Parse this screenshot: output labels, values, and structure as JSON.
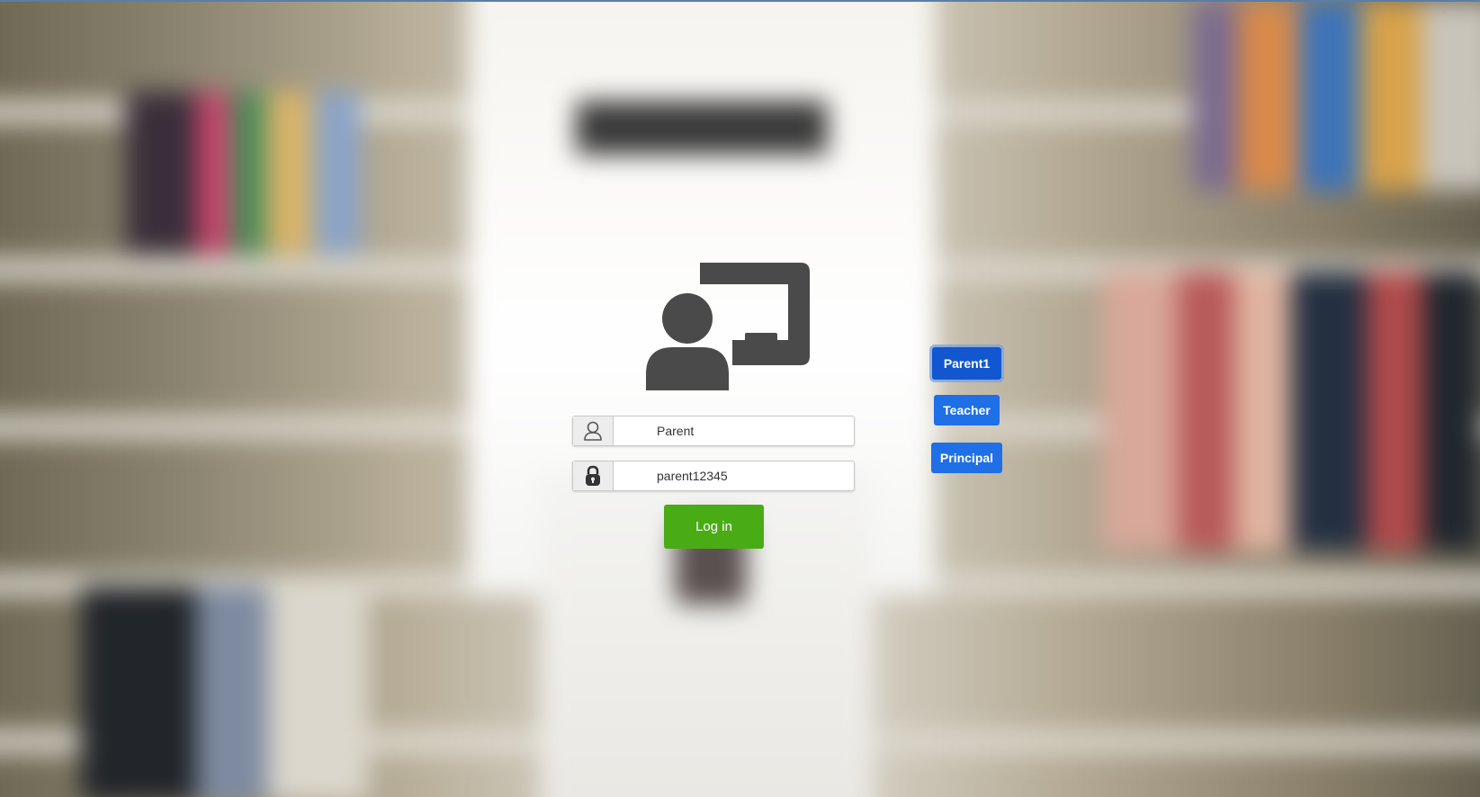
{
  "login": {
    "username_value": "Parent",
    "password_value": "parent12345",
    "login_label": "Log in"
  },
  "quick_roles": {
    "parent1_label": "Parent1",
    "teacher_label": "Teacher",
    "principal_label": "Principal"
  },
  "icons": {
    "logo": "teacher-board-icon",
    "username_addon": "user-icon",
    "password_addon": "lock-icon"
  },
  "colors": {
    "login_button": "#4aac15",
    "role_button": "#1f6fe6",
    "role_button_active": "#1257cf",
    "icon_gray": "#4a4a4a"
  }
}
